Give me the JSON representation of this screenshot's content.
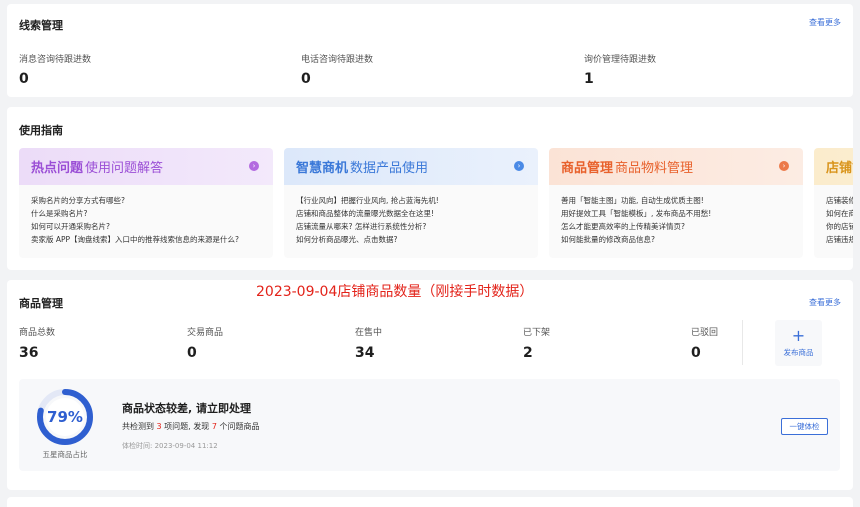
{
  "leads": {
    "title": "线索管理",
    "more": "查看更多",
    "stats": [
      {
        "label": "消息咨询待跟进数",
        "value": "0"
      },
      {
        "label": "电话咨询待跟进数",
        "value": "0"
      },
      {
        "label": "询价管理待跟进数",
        "value": "1"
      }
    ]
  },
  "guide": {
    "title": "使用指南",
    "boxes": [
      {
        "highlight": "热点问题",
        "subtitle": "使用问题解答",
        "accent": "#9b4fd6",
        "lines": [
          "采购名片的分享方式有哪些?",
          "什么是采购名片?",
          "如何可以开通采购名片?",
          "卖家版 APP【询盘线索】入口中的推荐线索信息的来源是什么?"
        ]
      },
      {
        "highlight": "智慧商机",
        "subtitle": "数据产品使用",
        "accent": "#3a78d8",
        "lines": [
          "【行业风向】把握行业风向, 抢占蓝海先机!",
          "店铺和商品整体的流量曝光数据全在这里!",
          "店铺流量从哪来? 怎样进行系统性分析?",
          "如何分析商品曝光、点击数据?"
        ]
      },
      {
        "highlight": "商品管理",
        "subtitle": "商品物料管理",
        "accent": "#e8612c",
        "lines": [
          "善用「智能主图」功能, 自动生成优质主图!",
          "用好提效工具「智能模板」, 发布商品不用愁!",
          "怎么才能更高效率的上传精美详情页?",
          "如何能批量的修改商品信息?"
        ]
      },
      {
        "highlight": "店铺管",
        "subtitle": "",
        "accent": "#d9941b",
        "lines": [
          "店铺装修",
          "如何在商",
          "你的店铺",
          "店铺违规"
        ]
      }
    ]
  },
  "annotation": "2023-09-04店铺商品数量（刚接手时数据）",
  "goods": {
    "title": "商品管理",
    "more": "查看更多",
    "stats": [
      {
        "label": "商品总数",
        "value": "36"
      },
      {
        "label": "交易商品",
        "value": "0"
      },
      {
        "label": "在售中",
        "value": "34"
      },
      {
        "label": "已下架",
        "value": "2"
      },
      {
        "label": "已驳回",
        "value": "0"
      }
    ],
    "publish": {
      "plus": "+",
      "label": "发布商品"
    },
    "health": {
      "percent": 79,
      "percent_label": "79%",
      "caption": "五星商品占比",
      "title": "商品状态较差, 请立即处理",
      "desc_prefix": "共检测到 ",
      "issues_items": "3",
      "desc_middle": " 项问题, 发现 ",
      "issues_goods": "7",
      "desc_suffix": " 个问题商品",
      "time": "体检时间: 2023-09-04 11:12",
      "button": "一键体检"
    }
  },
  "colors": {
    "accent_blue": "#3b6fd8",
    "alert_red": "#e3231a"
  }
}
